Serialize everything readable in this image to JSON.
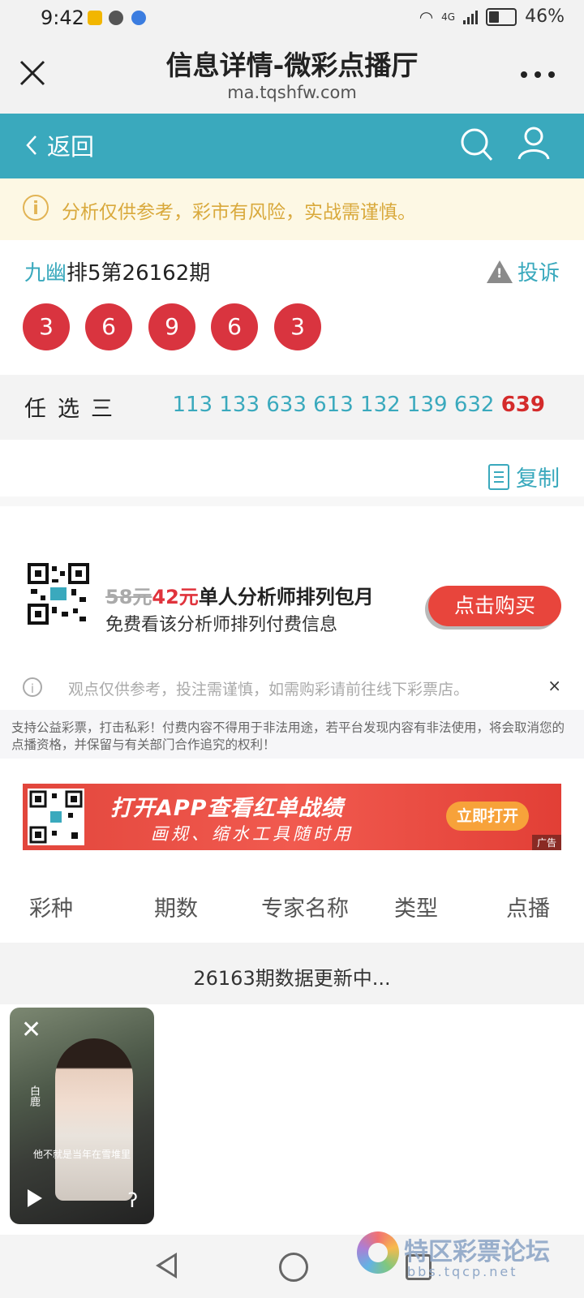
{
  "status_bar": {
    "time": "9:42",
    "network": "4G",
    "battery": "46%"
  },
  "title_bar": {
    "title": "信息详情-微彩点播厅",
    "url": "ma.tqshfw.com"
  },
  "nav": {
    "back_label": "返回"
  },
  "notice": {
    "text": "分析仅供参考，彩市有风险，实战需谨慎。"
  },
  "issue": {
    "author": "九幽",
    "rest": "排5第26162期",
    "complaint_label": "投诉"
  },
  "balls": [
    "3",
    "6",
    "9",
    "6",
    "3"
  ],
  "pick": {
    "label": "任选三",
    "numbers": "113 133 633 613 132 139 632",
    "highlight": "639"
  },
  "copy_label": "复制",
  "subscription": {
    "old_price": "58元",
    "new_price": "42元",
    "title": "单人分析师排列包月",
    "subtitle": "免费看该分析师排列付费信息",
    "buy_label": "点击购买"
  },
  "tip": {
    "text": "观点仅供参考，投注需谨慎，如需购彩请前往线下彩票店。",
    "close": "×"
  },
  "legal": {
    "text": "支持公益彩票，打击私彩！付费内容不得用于非法用途，若平台发现内容有非法使用，将会取消您的点播资格，并保留与有关部门合作追究的权利！"
  },
  "banner": {
    "headline": "打开APP查看红单战绩",
    "sub": "画规、缩水工具随时用",
    "button": "立即打开",
    "tag": "广告"
  },
  "table": {
    "headers": [
      "彩种",
      "期数",
      "专家名称",
      "类型",
      "点播"
    ],
    "updating": "26163期数据更新中..."
  },
  "video": {
    "caption": "他不就是当年在雪堆里",
    "close": "✕",
    "side_text": "白鹿"
  },
  "watermark": {
    "title": "特区彩票论坛",
    "sub": "bbs.tqcp.net"
  }
}
